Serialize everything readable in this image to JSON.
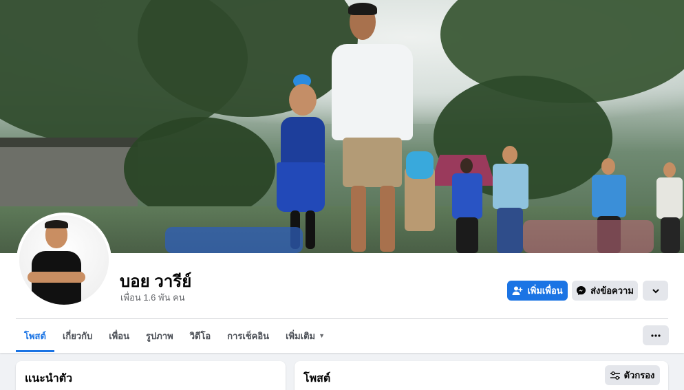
{
  "profile": {
    "name": "บอย วารีย์",
    "friends_count": "เพื่อน 1.6 พัน คน"
  },
  "actions": {
    "add_friend": "เพิ่มเพื่อน",
    "message": "ส่งข้อความ"
  },
  "tabs": [
    {
      "label": "โพสต์",
      "active": true
    },
    {
      "label": "เกี่ยวกับ",
      "active": false
    },
    {
      "label": "เพื่อน",
      "active": false
    },
    {
      "label": "รูปภาพ",
      "active": false
    },
    {
      "label": "วิดีโอ",
      "active": false
    },
    {
      "label": "การเช็คอิน",
      "active": false
    },
    {
      "label": "เพิ่มเติม",
      "active": false
    }
  ],
  "intro_card": {
    "title": "แนะนำตัว"
  },
  "posts_card": {
    "title": "โพสต์",
    "filter_label": "ตัวกรอง"
  },
  "colors": {
    "accent": "#1b74e4",
    "secondary_button": "#e4e6eb",
    "page_bg": "#f0f2f5"
  }
}
